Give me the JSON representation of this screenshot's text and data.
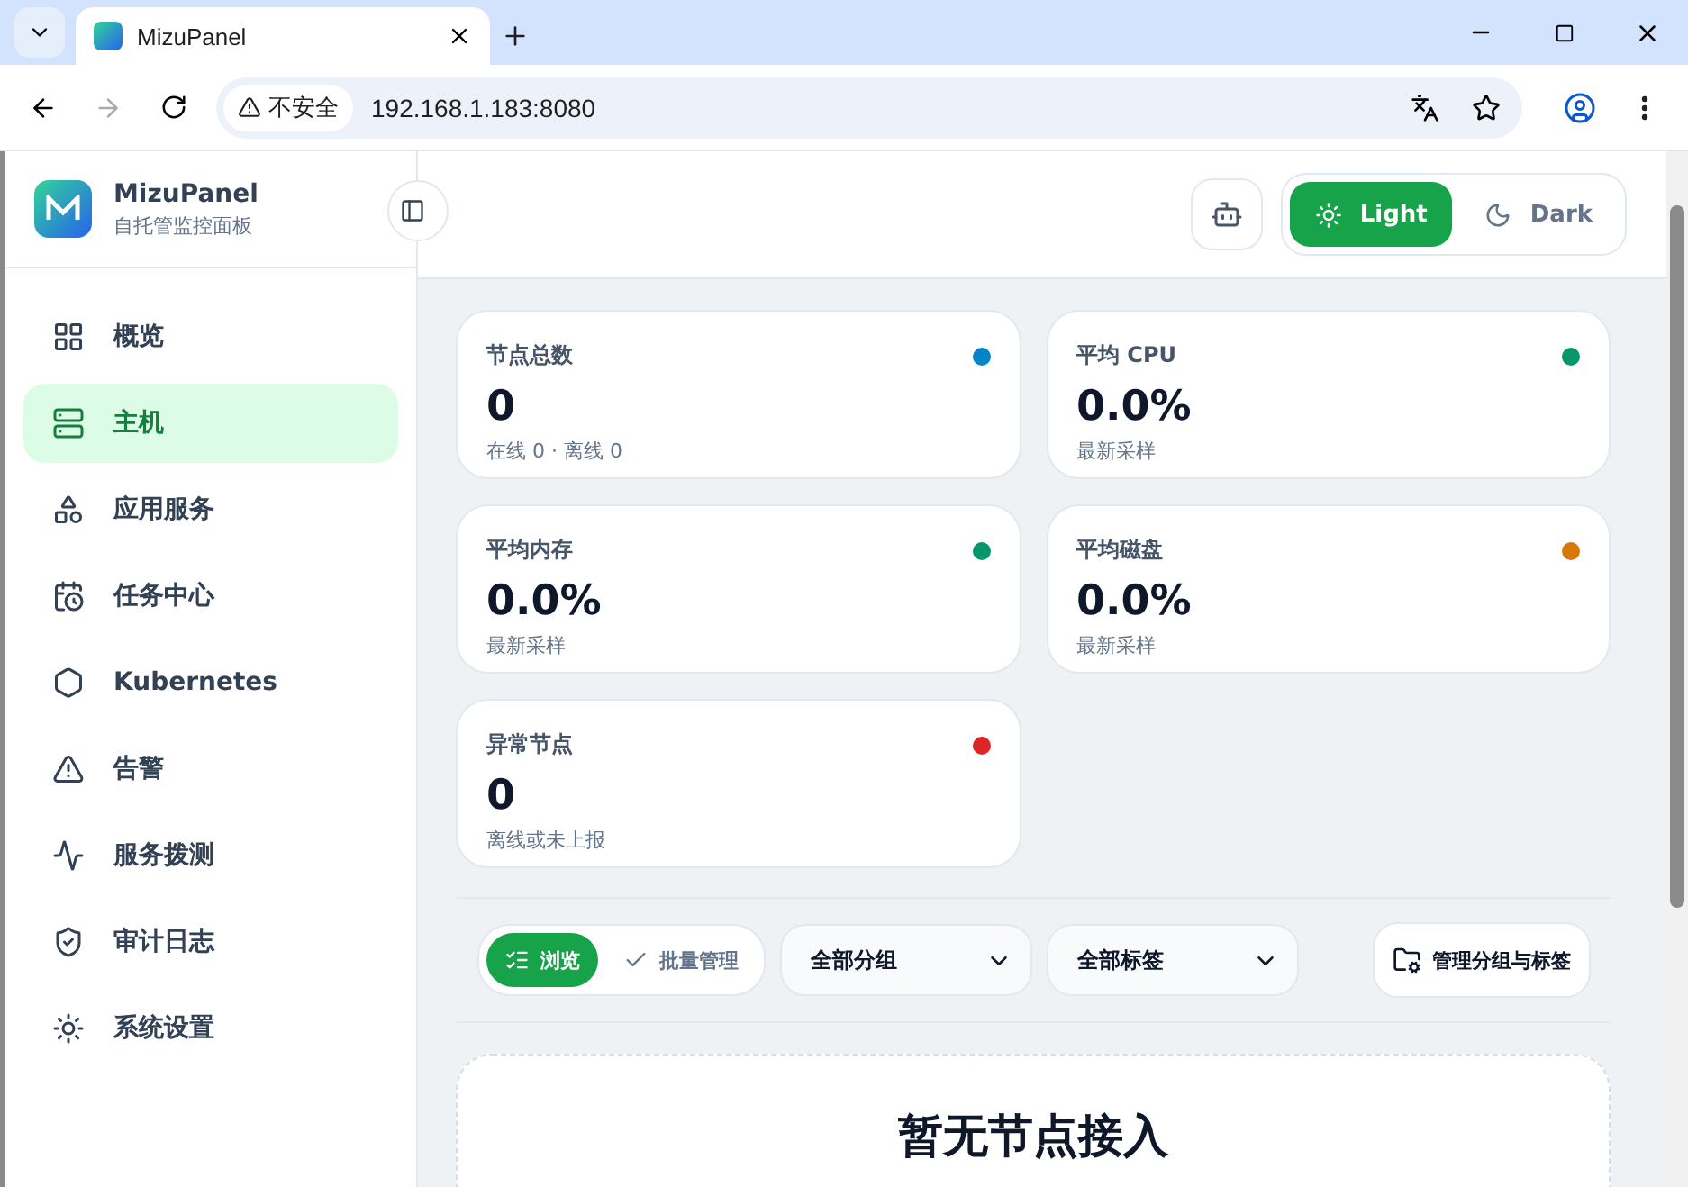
{
  "browser": {
    "tab_title": "MizuPanel",
    "security_label": "不安全",
    "url": "192.168.1.183:8080"
  },
  "sidebar": {
    "brand": "MizuPanel",
    "subtitle": "自托管监控面板",
    "items": [
      {
        "label": "概览",
        "selected": false
      },
      {
        "label": "主机",
        "selected": true
      },
      {
        "label": "应用服务",
        "selected": false
      },
      {
        "label": "任务中心",
        "selected": false
      },
      {
        "label": "Kubernetes",
        "selected": false
      },
      {
        "label": "告警",
        "selected": false
      },
      {
        "label": "服务拨测",
        "selected": false
      },
      {
        "label": "审计日志",
        "selected": false
      },
      {
        "label": "系统设置",
        "selected": false
      }
    ]
  },
  "theme_toggle": [
    {
      "label": "Light",
      "kind": "light",
      "selected": true
    },
    {
      "label": "Dark",
      "kind": "dark",
      "selected": false
    }
  ],
  "stats": [
    {
      "title": "节点总数",
      "value": "0",
      "note": "在线 0 · 离线 0",
      "color": "#0284c7"
    },
    {
      "title": "平均 CPU",
      "value": "0.0%",
      "note": "最新采样",
      "color": "#059669"
    },
    {
      "title": "平均内存",
      "value": "0.0%",
      "note": "最新采样",
      "color": "#059669"
    },
    {
      "title": "平均磁盘",
      "value": "0.0%",
      "note": "最新采样",
      "color": "#d97706"
    },
    {
      "title": "异常节点",
      "value": "0",
      "note": "离线或未上报",
      "color": "#dc2626"
    }
  ],
  "view_modes": [
    {
      "label": "浏览",
      "kind": "browse",
      "selected": true
    },
    {
      "label": "批量管理",
      "kind": "batch",
      "selected": false
    }
  ],
  "filters": [
    {
      "value": "全部分组"
    },
    {
      "value": "全部标签"
    }
  ],
  "manage_button": "管理分组与标签",
  "empty_state": {
    "title": "暂无节点接入"
  }
}
